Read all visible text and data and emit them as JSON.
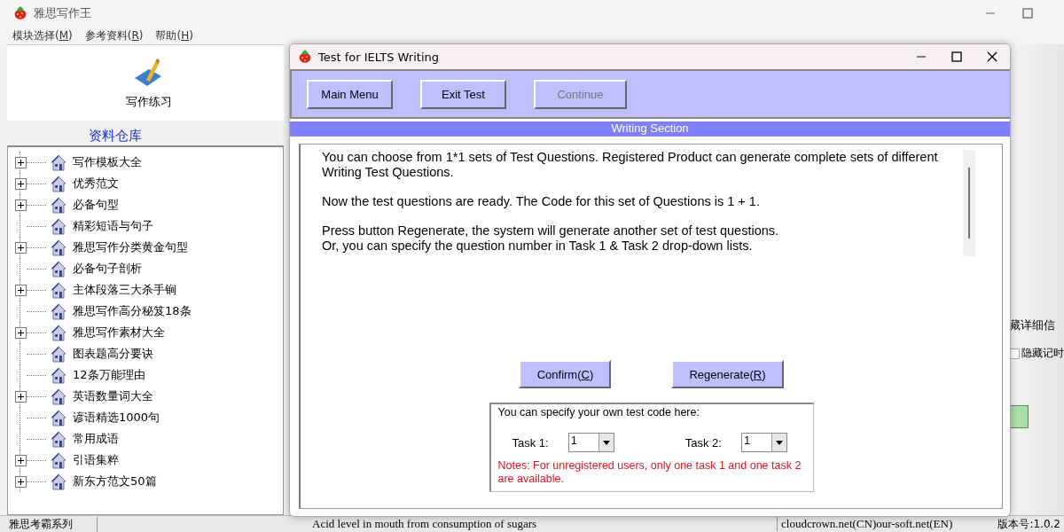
{
  "main_window": {
    "title": "雅思写作王",
    "menu": [
      {
        "before": "模块选择(",
        "key": "M",
        "after": ")"
      },
      {
        "before": "参考资料(",
        "key": "R",
        "after": ")"
      },
      {
        "before": "帮助(",
        "key": "H",
        "after": ")"
      }
    ],
    "toolbar": [
      {
        "label": "写作练习"
      }
    ],
    "library_title": "资料仓库",
    "tree": [
      {
        "label": "写作模板大全",
        "kind": "folder"
      },
      {
        "label": "优秀范文",
        "kind": "folder"
      },
      {
        "label": "必备句型",
        "kind": "folder"
      },
      {
        "label": "精彩短语与句子",
        "kind": "leaf"
      },
      {
        "label": "雅思写作分类黄金句型",
        "kind": "folder"
      },
      {
        "label": "必备句子剖析",
        "kind": "leaf"
      },
      {
        "label": "主体段落三大杀手锏",
        "kind": "folder"
      },
      {
        "label": "雅思写作高分秘笈18条",
        "kind": "leaf"
      },
      {
        "label": "雅思写作素材大全",
        "kind": "folder"
      },
      {
        "label": "图表题高分要诀",
        "kind": "leaf"
      },
      {
        "label": "12条万能理由",
        "kind": "leaf"
      },
      {
        "label": "英语数量词大全",
        "kind": "folder"
      },
      {
        "label": "谚语精选1000句",
        "kind": "leaf"
      },
      {
        "label": "常用成语",
        "kind": "leaf"
      },
      {
        "label": "引语集粹",
        "kind": "folder"
      },
      {
        "label": "新东方范文50篇",
        "kind": "folder"
      }
    ],
    "side_text": "藏详细信",
    "hide_timer": {
      "label": "隐藏记时",
      "checked": false
    },
    "status_bar": [
      "雅思考霸系列",
      "Acid level in mouth from consumption of sugars",
      "cloudcrown.net(CN)our-soft.net(EN)",
      "版本号:1.0.2"
    ]
  },
  "dialog": {
    "title": "Test for IELTS Writing",
    "buttons": [
      {
        "label": "Main Menu",
        "disabled": false
      },
      {
        "label": "Exit Test",
        "disabled": false
      },
      {
        "label": "Continue",
        "disabled": true
      }
    ],
    "section": "Writing Section",
    "paragraphs": [
      "You can choose from 1*1 sets of Test Questions. Registered Product can generate complete sets of different Writing Test Questions.",
      "Now the test questions are ready. The Code for this set of Questions is 1 + 1.",
      "Press button Regenerate, the system will generate another set of test questions.\nOr, you can specify the question number in Task 1 & Task 2 drop-down lists."
    ],
    "actions": [
      {
        "before": "Confirm(",
        "key": "C",
        "after": ")"
      },
      {
        "before": "Regenerate(",
        "key": "R",
        "after": ")"
      }
    ],
    "code_box": {
      "title": "You can specify your own test code here:",
      "tasks": [
        {
          "label": "Task 1:",
          "value": "1"
        },
        {
          "label": "Task 2:",
          "value": "1"
        }
      ],
      "note": "Notes: For unregistered users, only one task 1 and one task 2 are available."
    }
  }
}
